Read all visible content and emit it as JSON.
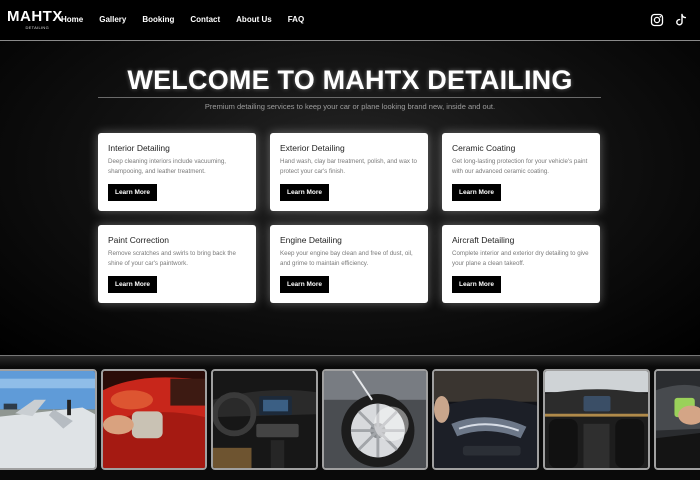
{
  "nav": {
    "logo": "MAHTX",
    "logo_sub": "DETAILING",
    "links": [
      "Home",
      "Gallery",
      "Booking",
      "Contact",
      "About Us",
      "FAQ"
    ],
    "icons": [
      "instagram-icon",
      "tiktok-icon"
    ]
  },
  "hero": {
    "title": "WELCOME TO MAHTX DETAILING",
    "subtitle": "Premium detailing services to keep your car or plane looking brand new, inside and out."
  },
  "services": [
    {
      "title": "Interior Detailing",
      "description": "Deep cleaning interiors include vacuuming, shampooing, and leather treatment.",
      "button": "Learn More"
    },
    {
      "title": "Exterior Detailing",
      "description": "Hand wash, clay bar treatment, polish, and wax to protect your car's finish.",
      "button": "Learn More"
    },
    {
      "title": "Ceramic Coating",
      "description": "Get long-lasting protection for your vehicle's paint with our advanced ceramic coating.",
      "button": "Learn More"
    },
    {
      "title": "Paint Correction",
      "description": "Remove scratches and swirls to bring back the shine of your car's paintwork.",
      "button": "Learn More"
    },
    {
      "title": "Engine Detailing",
      "description": "Keep your engine bay clean and free of dust, oil, and grime to maintain efficiency.",
      "button": "Learn More"
    },
    {
      "title": "Aircraft Detailing",
      "description": "Complete interior and exterior dry detailing to give your plane a clean takeoff.",
      "button": "Learn More"
    }
  ],
  "gallery": {
    "photos": [
      "aircraft-photo",
      "polishing-photo",
      "interior-dashboard-photo",
      "wheel-washing-photo",
      "headlight-photo",
      "car-interior-photo",
      "detailing-photo"
    ]
  },
  "colors": {
    "background": "#000000",
    "card": "#ffffff",
    "button": "#000000",
    "accent_red": "#c8261b"
  }
}
